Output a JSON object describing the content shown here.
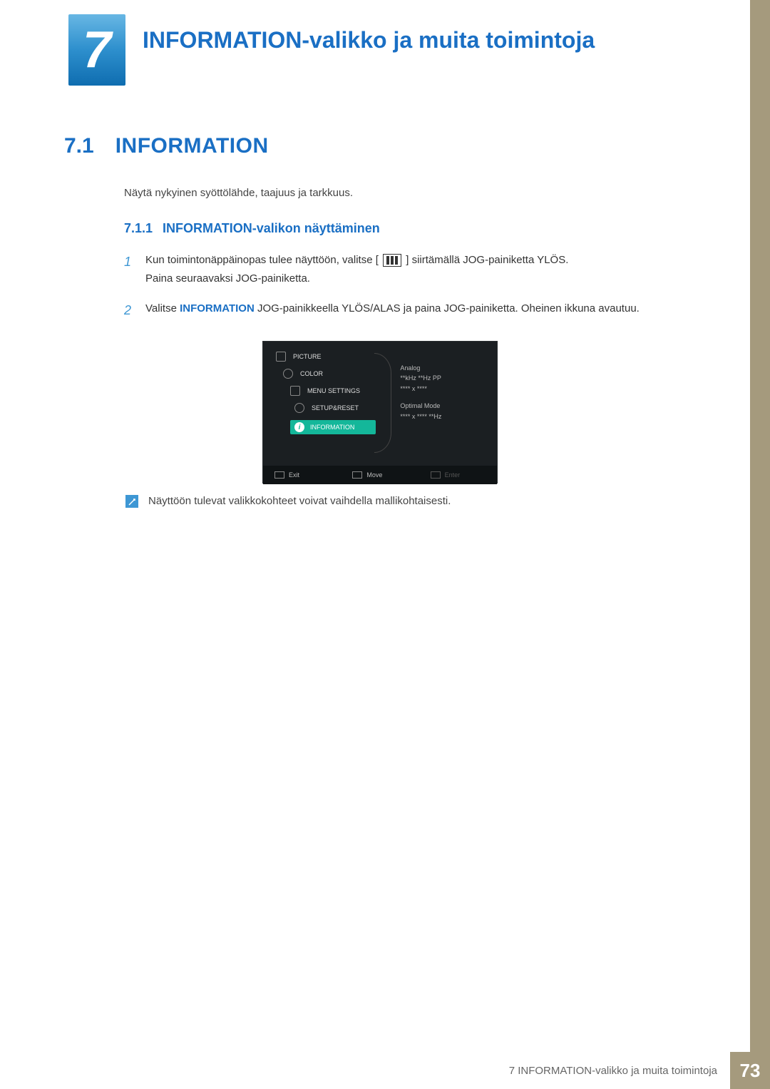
{
  "chapter": {
    "number": "7",
    "title": "INFORMATION-valikko ja muita toimintoja"
  },
  "section": {
    "number": "7.1",
    "title": "INFORMATION",
    "description": "Näytä nykyinen syöttölähde, taajuus ja tarkkuus."
  },
  "subsection": {
    "number": "7.1.1",
    "title": "INFORMATION-valikon näyttäminen"
  },
  "steps": {
    "s1": {
      "num": "1",
      "text_a": "Kun toimintonäppäinopas tulee näyttöön, valitse [",
      "text_b": "] siirtämällä JOG-painiketta YLÖS.",
      "text_c": "Paina seuraavaksi JOG-painiketta."
    },
    "s2": {
      "num": "2",
      "text_a": "Valitse ",
      "highlight": "INFORMATION",
      "text_b": " JOG-painikkeella YLÖS/ALAS ja paina JOG-painiketta. Oheinen ikkuna avautuu."
    }
  },
  "osd": {
    "menu": {
      "picture": "PICTURE",
      "color": "COLOR",
      "menu_settings": "MENU SETTINGS",
      "setup_reset": "SETUP&RESET",
      "information": "INFORMATION"
    },
    "info": {
      "line1": "Analog",
      "line2": "**kHz **Hz PP",
      "line3": "**** x ****",
      "line4": "Optimal Mode",
      "line5": "**** x **** **Hz"
    },
    "footer": {
      "exit": "Exit",
      "move": "Move",
      "enter": "Enter"
    }
  },
  "note": "Näyttöön tulevat valikkokohteet voivat vaihdella mallikohtaisesti.",
  "footer": {
    "text": "7 INFORMATION-valikko ja muita toimintoja",
    "page": "73"
  }
}
